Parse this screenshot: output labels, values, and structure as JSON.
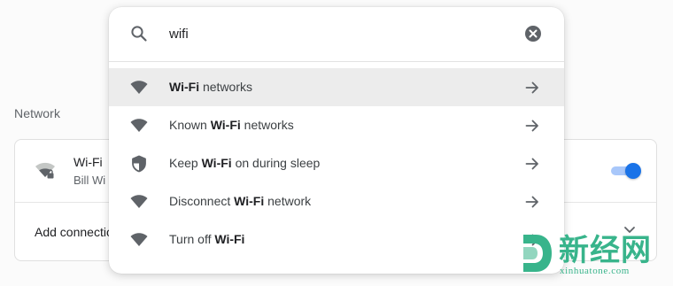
{
  "settings": {
    "section_title": "Network",
    "wifi_row": {
      "title": "Wi-Fi",
      "subtitle": "Bill Wi",
      "icon": "wifi-secured-icon",
      "toggle_on": true
    },
    "add_connection_label": "Add connection",
    "expand_icon": "chevron-down-icon"
  },
  "search": {
    "query": "wifi",
    "search_icon": "search-icon",
    "clear_icon": "clear-icon",
    "results": [
      {
        "icon": "wifi-icon",
        "before": "",
        "bold": "Wi-Fi",
        "after": " networks",
        "selected": true
      },
      {
        "icon": "wifi-icon",
        "before": "Known ",
        "bold": "Wi-Fi",
        "after": " networks",
        "selected": false
      },
      {
        "icon": "shield-icon",
        "before": "Keep ",
        "bold": "Wi-Fi",
        "after": " on during sleep",
        "selected": false
      },
      {
        "icon": "wifi-icon",
        "before": "Disconnect ",
        "bold": "Wi-Fi",
        "after": " network",
        "selected": false
      },
      {
        "icon": "wifi-icon",
        "before": "Turn off ",
        "bold": "Wi-Fi",
        "after": "",
        "selected": false
      }
    ]
  },
  "watermark": {
    "chinese": "新经网",
    "latin": "xinhuatone.com"
  },
  "colors": {
    "accent": "#1a73e8",
    "toggle_track": "#a8c7fa",
    "selected_row": "#ececec",
    "watermark": "#38b48b"
  }
}
